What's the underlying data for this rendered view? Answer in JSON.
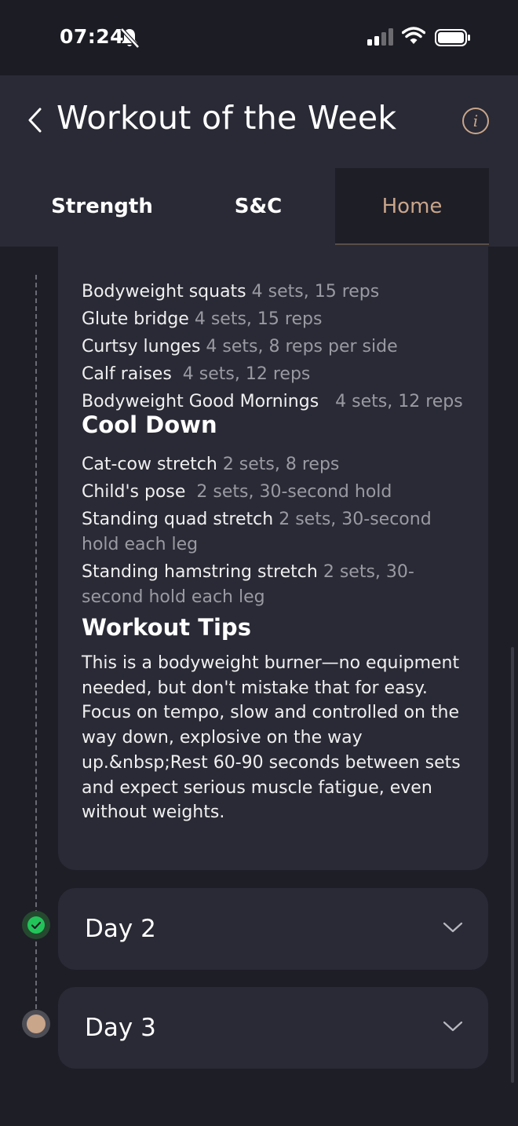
{
  "status_bar": {
    "time": "07:24"
  },
  "header": {
    "title": "Workout of the Week",
    "info_label": "i",
    "tabs": [
      {
        "label": "Strength"
      },
      {
        "label": "S&C"
      },
      {
        "label": "Home"
      }
    ],
    "active_tab": "Home"
  },
  "workout": {
    "main_exercises": [
      {
        "name": "Bodyweight squats",
        "sets": "4 sets, 15 reps"
      },
      {
        "name": "Glute bridge",
        "sets": "4 sets, 15 reps"
      },
      {
        "name": "Curtsy lunges",
        "sets": "4 sets, 8 reps per side"
      },
      {
        "name": "Calf raises",
        "sets": "4 sets, 12 reps"
      },
      {
        "name": "Bodyweight Good Mornings",
        "sets": "4 sets, 12 reps"
      }
    ],
    "cool_down_title": "Cool Down",
    "cool_down": [
      {
        "name": "Cat-cow stretch",
        "sets": "2 sets, 8 reps"
      },
      {
        "name": "Child's pose",
        "sets": "2 sets, 30-second hold"
      },
      {
        "name": "Standing quad stretch",
        "sets": "2 sets, 30-second hold each leg"
      },
      {
        "name": "Standing hamstring stretch",
        "sets": "2 sets, 30-second hold each leg"
      }
    ],
    "tips_title": "Workout Tips",
    "tips_text": "This is a bodyweight burner—no equipment needed, but don't mistake that for easy. Focus on tempo, slow and controlled on the way down, explosive on the way up.&nbsp;Rest 60-90 seconds between sets and expect serious muscle fatigue, even without weights."
  },
  "days": [
    {
      "label": "Day 2",
      "status": "completed"
    },
    {
      "label": "Day 3",
      "status": "pending"
    }
  ],
  "colors": {
    "background": "#1e1e27",
    "card": "#292a35",
    "accent": "#c9a58a",
    "completed": "#22c45a",
    "muted_text": "#9a9aa2"
  }
}
